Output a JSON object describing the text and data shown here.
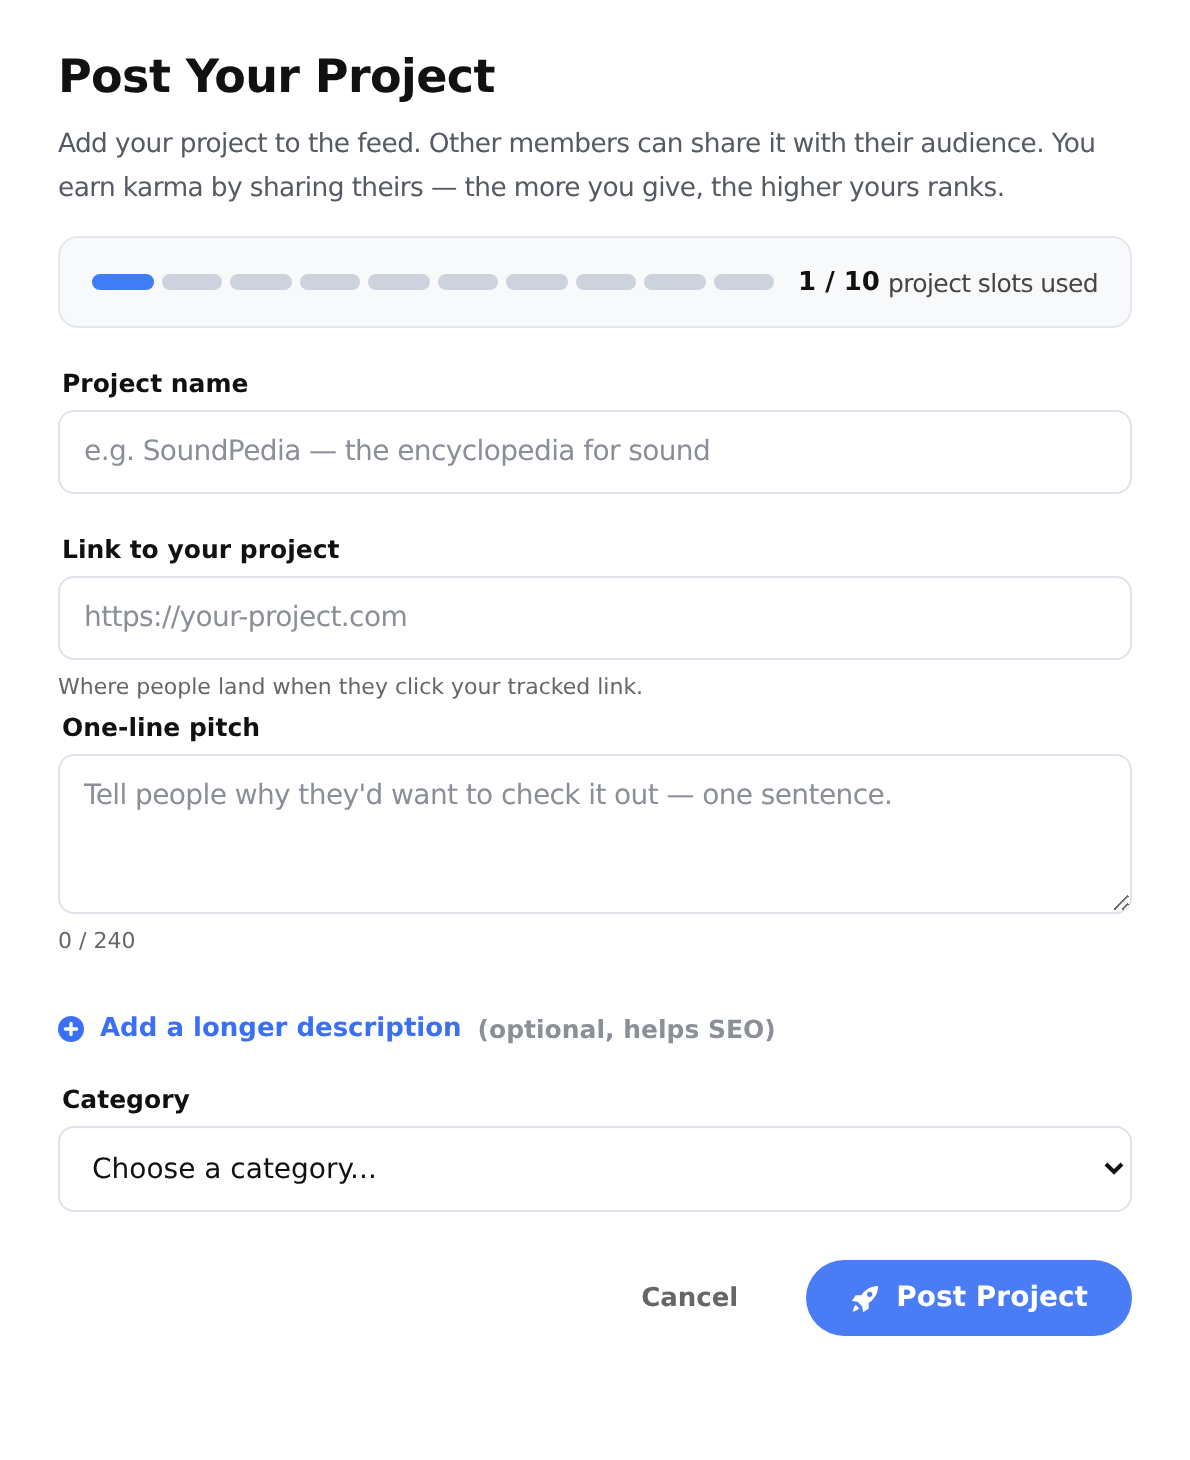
{
  "title": "Post Your Project",
  "intro": "Add your project to the feed. Other members can share it with their audience. You earn karma by sharing theirs — the more you give, the higher yours ranks.",
  "slots": {
    "segments": [
      {
        "filled": true
      },
      {
        "filled": false
      },
      {
        "filled": false
      },
      {
        "filled": false
      },
      {
        "filled": false
      },
      {
        "filled": false
      },
      {
        "filled": false
      },
      {
        "filled": false
      },
      {
        "filled": false
      },
      {
        "filled": false
      }
    ],
    "count": "1 / 10",
    "label": "project slots used"
  },
  "fields": [
    {
      "kind": "text",
      "label": "Project name",
      "placeholder": "e.g. SoundPedia — the encyclopedia for sound"
    },
    {
      "kind": "text",
      "label": "Link to your project",
      "placeholder": "https://your-project.com",
      "hint": "Where people land when they click your tracked link."
    },
    {
      "kind": "textarea",
      "label": "One-line pitch",
      "placeholder": "Tell people why they'd want to check it out — one sentence.",
      "hint": "0 / 240"
    }
  ],
  "expand_link": {
    "label": "Add a longer description",
    "note": "(optional, helps SEO)"
  },
  "category": {
    "label": "Category",
    "value": "Choose a category..."
  },
  "buttons": {
    "cancel": "Cancel",
    "submit": "Post Project"
  }
}
